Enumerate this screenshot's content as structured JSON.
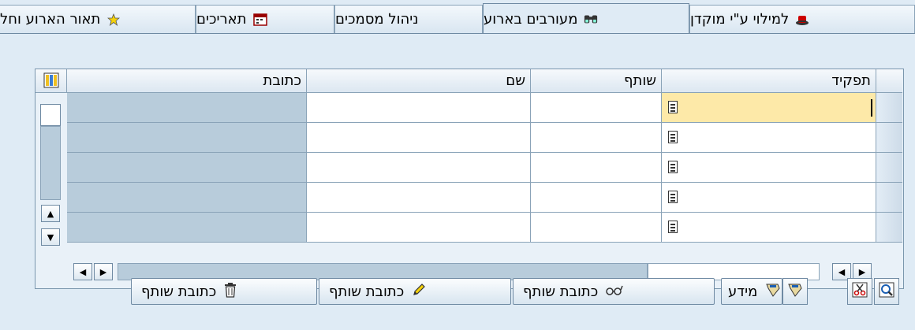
{
  "tabs": [
    {
      "label": "למילוי ע\"י מוקדן",
      "icon": "hat-icon"
    },
    {
      "label": "מעורבים בארוע",
      "icon": "binoculars-icon"
    },
    {
      "label": "ניהול מסמכים",
      "icon": ""
    },
    {
      "label": "תאריכים",
      "icon": "calendar-icon"
    },
    {
      "label": "תאור הארוע וחל",
      "icon": "star-icon"
    }
  ],
  "table": {
    "columns": [
      "תפקיד",
      "שותף",
      "שם",
      "כתובת"
    ],
    "rows": [
      {
        "role": "",
        "partner": "",
        "name": "",
        "address": ""
      },
      {
        "role": "",
        "partner": "",
        "name": "",
        "address": ""
      },
      {
        "role": "",
        "partner": "",
        "name": "",
        "address": ""
      },
      {
        "role": "",
        "partner": "",
        "name": "",
        "address": ""
      },
      {
        "role": "",
        "partner": "",
        "name": "",
        "address": ""
      }
    ]
  },
  "buttons": {
    "info": "מידע",
    "display_address": "כתובת שותף",
    "edit_address": "כתובת שותף",
    "delete_address": "כתובת שותף"
  },
  "colors": {
    "background": "#dfebf5",
    "selected_cell": "#fde9a8",
    "readonly_cell": "#b8ccdb"
  }
}
